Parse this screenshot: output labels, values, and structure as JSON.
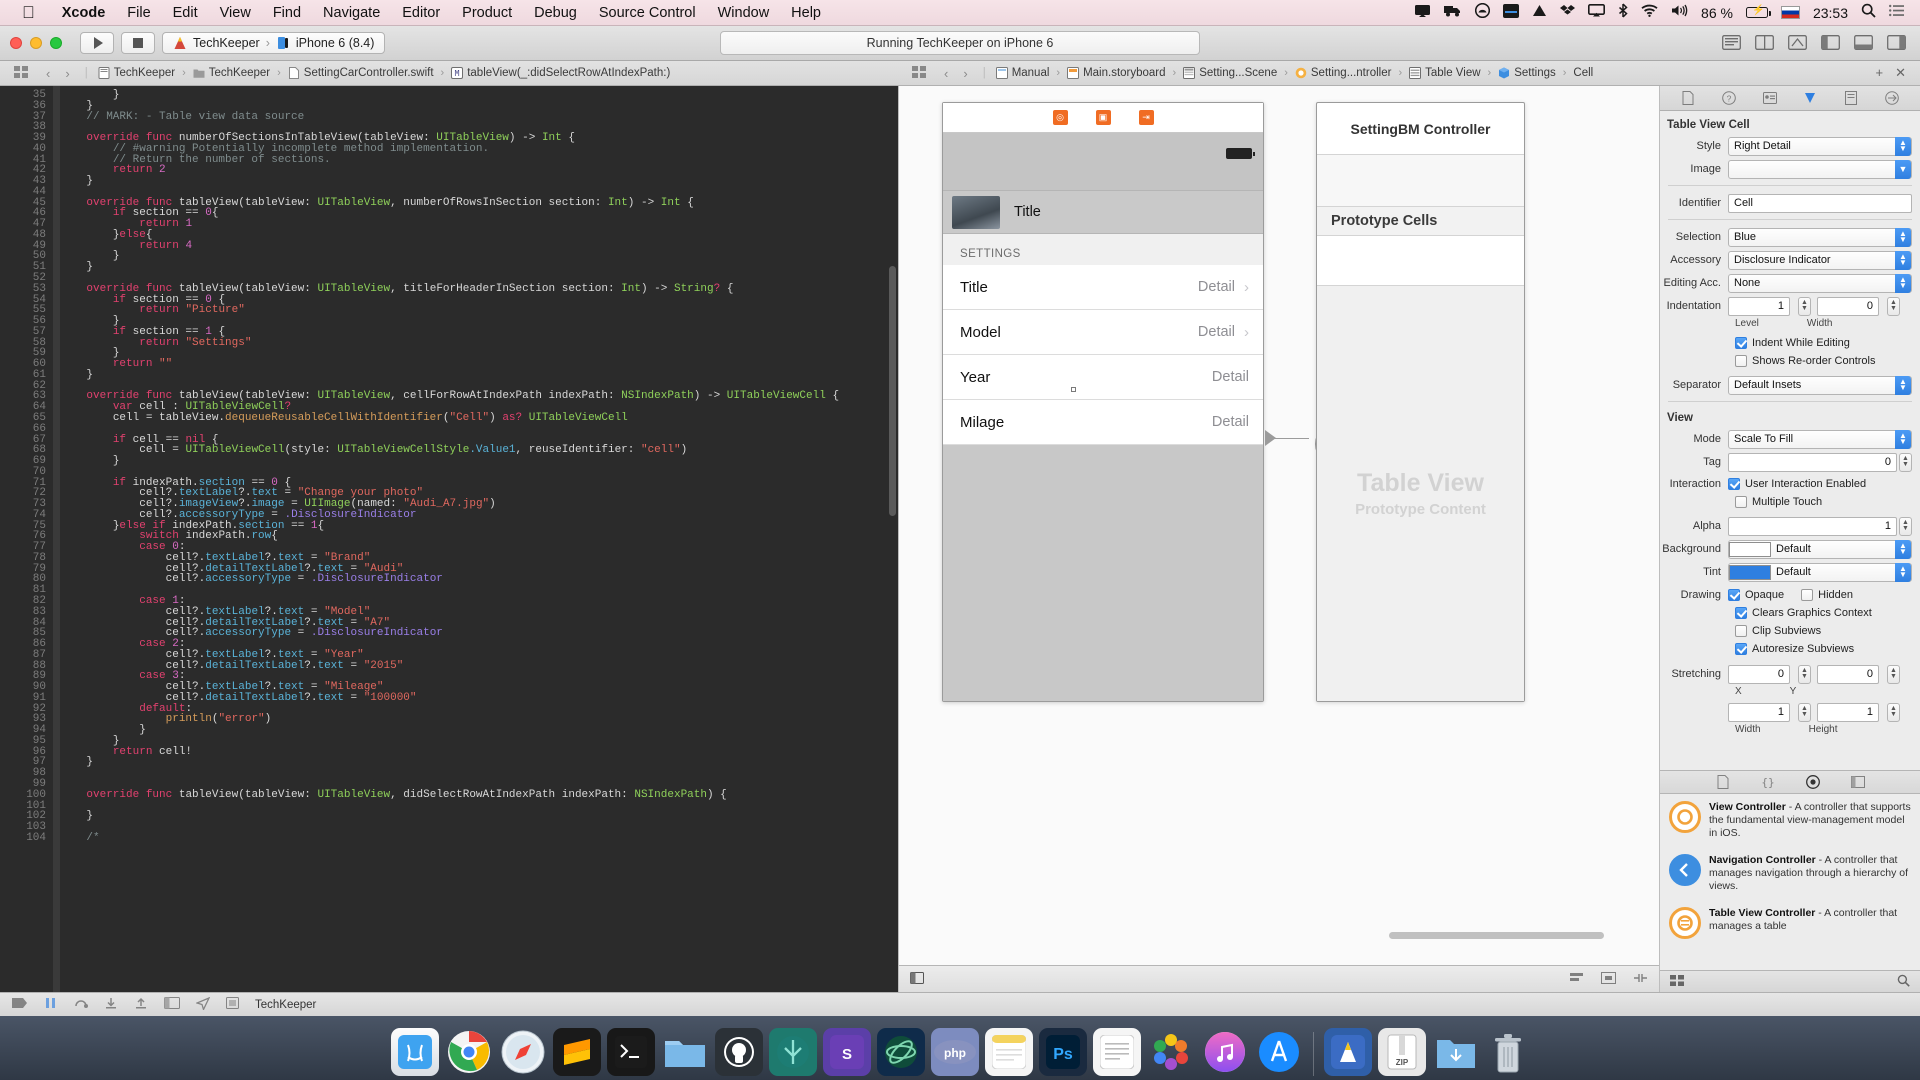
{
  "menubar": {
    "apple": "",
    "items": [
      "Xcode",
      "File",
      "Edit",
      "View",
      "Find",
      "Navigate",
      "Editor",
      "Product",
      "Debug",
      "Source Control",
      "Window",
      "Help"
    ],
    "status": {
      "battery_percent": "86 %",
      "time": "23:53",
      "locale_flag": "RU"
    }
  },
  "toolbar": {
    "run_label": "Run",
    "stop_label": "Stop",
    "scheme": "TechKeeper",
    "destination": "iPhone 6 (8.4)",
    "activity": "Running TechKeeper on iPhone 6"
  },
  "jumpbar": {
    "left": [
      "TechKeeper",
      "TechKeeper",
      "SettingCarController.swift",
      "tableView(_:didSelectRowAtIndexPath:)"
    ],
    "right": [
      "Manual",
      "Main.storyboard",
      "Setting...Scene",
      "Setting...ntroller",
      "Table View",
      "Settings",
      "Cell"
    ]
  },
  "editor": {
    "first_line": 35,
    "lines": [
      {
        "n": 35,
        "html": "        <span class='pln'>}</span>"
      },
      {
        "n": 36,
        "html": "    <span class='pln'>}</span>"
      },
      {
        "n": 37,
        "html": "    <span class='cm'>// MARK: - Table view data source</span>"
      },
      {
        "n": 38,
        "html": ""
      },
      {
        "n": 39,
        "html": "    <span class='kw'>override</span> <span class='kw'>func</span> <span class='pln'>numberOfSectionsInTableView(tableView:</span> <span class='ty'>UITableView</span><span class='pln'>) -&gt;</span> <span class='ty'>Int</span> <span class='pln'>{</span>"
      },
      {
        "n": 40,
        "html": "        <span class='cm'>// #warning Potentially incomplete method implementation.</span>"
      },
      {
        "n": 41,
        "html": "        <span class='cm'>// Return the number of sections.</span>"
      },
      {
        "n": 42,
        "html": "        <span class='kw'>return</span> <span class='num'>2</span>"
      },
      {
        "n": 43,
        "html": "    <span class='pln'>}</span>"
      },
      {
        "n": 44,
        "html": ""
      },
      {
        "n": 45,
        "html": "    <span class='kw'>override</span> <span class='kw'>func</span> <span class='pln'>tableView(tableView:</span> <span class='ty'>UITableView</span><span class='pln'>, numberOfRowsInSection section:</span> <span class='ty'>Int</span><span class='pln'>) -&gt;</span> <span class='ty'>Int</span> <span class='pln'>{</span>"
      },
      {
        "n": 46,
        "html": "        <span class='kw'>if</span> <span class='pln'>section ==</span> <span class='num'>0</span><span class='pln'>{</span>"
      },
      {
        "n": 47,
        "html": "            <span class='kw'>return</span> <span class='num'>1</span>"
      },
      {
        "n": 48,
        "html": "        <span class='pln'>}</span><span class='kw'>else</span><span class='pln'>{</span>"
      },
      {
        "n": 49,
        "html": "            <span class='kw'>return</span> <span class='num'>4</span>"
      },
      {
        "n": 50,
        "html": "        <span class='pln'>}</span>"
      },
      {
        "n": 51,
        "html": "    <span class='pln'>}</span>"
      },
      {
        "n": 52,
        "html": ""
      },
      {
        "n": 53,
        "html": "    <span class='kw'>override</span> <span class='kw'>func</span> <span class='pln'>tableView(tableView:</span> <span class='ty'>UITableView</span><span class='pln'>, titleForHeaderInSection section:</span> <span class='ty'>Int</span><span class='pln'>) -&gt;</span> <span class='ty'>String</span><span class='kw'>?</span> <span class='pln'>{</span>"
      },
      {
        "n": 54,
        "html": "        <span class='kw'>if</span> <span class='pln'>section ==</span> <span class='num'>0</span> <span class='pln'>{</span>"
      },
      {
        "n": 55,
        "html": "            <span class='kw'>return</span> <span class='str'>\"Picture\"</span>"
      },
      {
        "n": 56,
        "html": "        <span class='pln'>}</span>"
      },
      {
        "n": 57,
        "html": "        <span class='kw'>if</span> <span class='pln'>section ==</span> <span class='num'>1</span> <span class='pln'>{</span>"
      },
      {
        "n": 58,
        "html": "            <span class='kw'>return</span> <span class='str'>\"Settings\"</span>"
      },
      {
        "n": 59,
        "html": "        <span class='pln'>}</span>"
      },
      {
        "n": 60,
        "html": "        <span class='kw'>return</span> <span class='str'>\"\"</span>"
      },
      {
        "n": 61,
        "html": "    <span class='pln'>}</span>"
      },
      {
        "n": 62,
        "html": ""
      },
      {
        "n": 63,
        "html": "    <span class='kw'>override</span> <span class='kw'>func</span> <span class='pln'>tableView(tableView:</span> <span class='ty'>UITableView</span><span class='pln'>, cellForRowAtIndexPath indexPath:</span> <span class='ty'>NSIndexPath</span><span class='pln'>) -&gt;</span> <span class='ty'>UITableViewCell</span> <span class='pln'>{</span>"
      },
      {
        "n": 64,
        "html": "        <span class='kw'>var</span> <span class='pln'>cell :</span> <span class='ty'>UITableViewCell</span><span class='kw'>?</span>"
      },
      {
        "n": 65,
        "html": "        <span class='pln'>cell = tableView.</span><span class='mth'>dequeueReusableCellWithIdentifier</span><span class='pln'>(</span><span class='str'>\"Cell\"</span><span class='pln'>)</span> <span class='kw'>as?</span> <span class='ty'>UITableViewCell</span>"
      },
      {
        "n": 66,
        "html": ""
      },
      {
        "n": 67,
        "html": "        <span class='kw'>if</span> <span class='pln'>cell ==</span> <span class='kw'>nil</span> <span class='pln'>{</span>"
      },
      {
        "n": 68,
        "html": "            <span class='pln'>cell =</span> <span class='ty'>UITableViewCell</span><span class='pln'>(style:</span> <span class='ty'>UITableViewCellStyle</span><span class='prp'>.Value1</span><span class='pln'>, reuseIdentifier:</span> <span class='str'>\"cell\"</span><span class='pln'>)</span>"
      },
      {
        "n": 69,
        "html": "        <span class='pln'>}</span>"
      },
      {
        "n": 70,
        "html": ""
      },
      {
        "n": 71,
        "html": "        <span class='kw'>if</span> <span class='pln'>indexPath.</span><span class='prp'>section</span> <span class='pln'>==</span> <span class='num'>0</span> <span class='pln'>{</span>"
      },
      {
        "n": 72,
        "html": "            <span class='pln'>cell?.</span><span class='prp'>textLabel</span><span class='pln'>?.</span><span class='prp'>text</span> <span class='pln'>=</span> <span class='str'>\"Change your photo\"</span>"
      },
      {
        "n": 73,
        "html": "            <span class='pln'>cell?.</span><span class='prp'>imageView</span><span class='pln'>?.</span><span class='prp'>image</span> <span class='pln'>=</span> <span class='ty'>UIImage</span><span class='pln'>(named:</span> <span class='str'>\"Audi_A7.jpg\"</span><span class='pln'>)</span>"
      },
      {
        "n": 74,
        "html": "            <span class='pln'>cell?.</span><span class='prp'>accessoryType</span> <span class='pln'>=</span> <span class='enm'>.DisclosureIndicator</span>"
      },
      {
        "n": 75,
        "html": "        <span class='pln'>}</span><span class='kw'>else if</span> <span class='pln'>indexPath.</span><span class='prp'>section</span> <span class='pln'>==</span> <span class='num'>1</span><span class='pln'>{</span>"
      },
      {
        "n": 76,
        "html": "            <span class='kw'>switch</span> <span class='pln'>indexPath.</span><span class='prp'>row</span><span class='pln'>{</span>"
      },
      {
        "n": 77,
        "html": "            <span class='kw'>case</span> <span class='num'>0</span><span class='pln'>:</span>"
      },
      {
        "n": 78,
        "html": "                <span class='pln'>cell?.</span><span class='prp'>textLabel</span><span class='pln'>?.</span><span class='prp'>text</span> <span class='pln'>=</span> <span class='str'>\"Brand\"</span>"
      },
      {
        "n": 79,
        "html": "                <span class='pln'>cell?.</span><span class='prp'>detailTextLabel</span><span class='pln'>?.</span><span class='prp'>text</span> <span class='pln'>=</span> <span class='str'>\"Audi\"</span>"
      },
      {
        "n": 80,
        "html": "                <span class='pln'>cell?.</span><span class='prp'>accessoryType</span> <span class='pln'>=</span> <span class='enm'>.DisclosureIndicator</span>"
      },
      {
        "n": 81,
        "html": ""
      },
      {
        "n": 82,
        "html": "            <span class='kw'>case</span> <span class='num'>1</span><span class='pln'>:</span>"
      },
      {
        "n": 83,
        "html": "                <span class='pln'>cell?.</span><span class='prp'>textLabel</span><span class='pln'>?.</span><span class='prp'>text</span> <span class='pln'>=</span> <span class='str'>\"Model\"</span>"
      },
      {
        "n": 84,
        "html": "                <span class='pln'>cell?.</span><span class='prp'>detailTextLabel</span><span class='pln'>?.</span><span class='prp'>text</span> <span class='pln'>=</span> <span class='str'>\"A7\"</span>"
      },
      {
        "n": 85,
        "html": "                <span class='pln'>cell?.</span><span class='prp'>accessoryType</span> <span class='pln'>=</span> <span class='enm'>.DisclosureIndicator</span>"
      },
      {
        "n": 86,
        "html": "            <span class='kw'>case</span> <span class='num'>2</span><span class='pln'>:</span>"
      },
      {
        "n": 87,
        "html": "                <span class='pln'>cell?.</span><span class='prp'>textLabel</span><span class='pln'>?.</span><span class='prp'>text</span> <span class='pln'>=</span> <span class='str'>\"Year\"</span>"
      },
      {
        "n": 88,
        "html": "                <span class='pln'>cell?.</span><span class='prp'>detailTextLabel</span><span class='pln'>?.</span><span class='prp'>text</span> <span class='pln'>=</span> <span class='str'>\"2015\"</span>"
      },
      {
        "n": 89,
        "html": "            <span class='kw'>case</span> <span class='num'>3</span><span class='pln'>:</span>"
      },
      {
        "n": 90,
        "html": "                <span class='pln'>cell?.</span><span class='prp'>textLabel</span><span class='pln'>?.</span><span class='prp'>text</span> <span class='pln'>=</span> <span class='str'>\"Mileage\"</span>"
      },
      {
        "n": 91,
        "html": "                <span class='pln'>cell?.</span><span class='prp'>detailTextLabel</span><span class='pln'>?.</span><span class='prp'>text</span> <span class='pln'>=</span> <span class='str'>\"100000\"</span>"
      },
      {
        "n": 92,
        "html": "            <span class='kw'>default</span><span class='pln'>:</span>"
      },
      {
        "n": 93,
        "html": "                <span class='mth'>println</span><span class='pln'>(</span><span class='str'>\"error\"</span><span class='pln'>)</span>"
      },
      {
        "n": 94,
        "html": "            <span class='pln'>}</span>"
      },
      {
        "n": 95,
        "html": "        <span class='pln'>}</span>"
      },
      {
        "n": 96,
        "html": "        <span class='kw'>return</span> <span class='pln'>cell!</span>"
      },
      {
        "n": 97,
        "html": "    <span class='pln'>}</span>"
      },
      {
        "n": 98,
        "html": ""
      },
      {
        "n": 99,
        "html": ""
      },
      {
        "n": 100,
        "html": "    <span class='kw'>override</span> <span class='kw'>func</span> <span class='pln'>tableView(tableView:</span> <span class='ty'>UITableView</span><span class='pln'>, didSelectRowAtIndexPath indexPath:</span> <span class='ty'>NSIndexPath</span><span class='pln'>) {</span>"
      },
      {
        "n": 101,
        "html": ""
      },
      {
        "n": 102,
        "html": "    <span class='pln'>}</span>"
      },
      {
        "n": 103,
        "html": ""
      },
      {
        "n": 104,
        "html": "    <span class='cm'>/*</span>"
      }
    ]
  },
  "storyboard": {
    "phone": {
      "cell_title": "Title",
      "section_header": "SETTINGS",
      "rows": [
        {
          "label": "Title",
          "detail": "Detail",
          "chevron": true
        },
        {
          "label": "Model",
          "detail": "Detail",
          "chevron": true
        },
        {
          "label": "Year",
          "detail": "Detail",
          "chevron": false
        },
        {
          "label": "Milage",
          "detail": "Detail",
          "chevron": false
        }
      ]
    },
    "table_view_controller": {
      "title": "SettingBM Controller",
      "prototype_cells_label": "Prototype Cells",
      "placeholder_line1": "Table View",
      "placeholder_line2": "Prototype Content"
    }
  },
  "inspector": {
    "section_title": "Table View Cell",
    "fields": {
      "style_label": "Style",
      "style_value": "Right Detail",
      "image_label": "Image",
      "image_value": "",
      "identifier_label": "Identifier",
      "identifier_value": "Cell",
      "selection_label": "Selection",
      "selection_value": "Blue",
      "accessory_label": "Accessory",
      "accessory_value": "Disclosure Indicator",
      "editing_acc_label": "Editing Acc.",
      "editing_acc_value": "None",
      "indentation_label": "Indentation",
      "indentation_level": "1",
      "indentation_width": "0",
      "sub_level": "Level",
      "sub_width": "Width",
      "indent_while_editing": "Indent While Editing",
      "shows_reorder": "Shows Re-order Controls",
      "separator_label": "Separator",
      "separator_value": "Default Insets"
    },
    "view_section": {
      "title": "View",
      "mode_label": "Mode",
      "mode_value": "Scale To Fill",
      "tag_label": "Tag",
      "tag_value": "0",
      "interaction_label": "Interaction",
      "user_interaction": "User Interaction Enabled",
      "multiple_touch": "Multiple Touch",
      "alpha_label": "Alpha",
      "alpha_value": "1",
      "background_label": "Background",
      "background_value": "Default",
      "tint_label": "Tint",
      "tint_value": "Default",
      "drawing_label": "Drawing",
      "opaque": "Opaque",
      "hidden": "Hidden",
      "clears_graphics": "Clears Graphics Context",
      "clip_subviews": "Clip Subviews",
      "autoresize_subviews": "Autoresize Subviews",
      "stretching_label": "Stretching",
      "stretch_x": "0",
      "stretch_y": "0",
      "stretch_w": "1",
      "stretch_h": "1",
      "sub_x": "X",
      "sub_y": "Y",
      "sub_w": "Width",
      "sub_h": "Height"
    }
  },
  "library": {
    "items": [
      {
        "title": "View Controller",
        "desc": " - A controller that supports the fundamental view-management model in iOS."
      },
      {
        "title": "Navigation Controller",
        "desc": " - A controller that manages navigation through a hierarchy of views."
      },
      {
        "title": "Table View Controller",
        "desc": " - A controller that manages a table"
      }
    ]
  },
  "bottombar": {
    "project": "TechKeeper"
  },
  "colors": {
    "accent": "#2f7fe0",
    "orange": "#f06c23",
    "editor_bg": "#2b2b2b"
  }
}
